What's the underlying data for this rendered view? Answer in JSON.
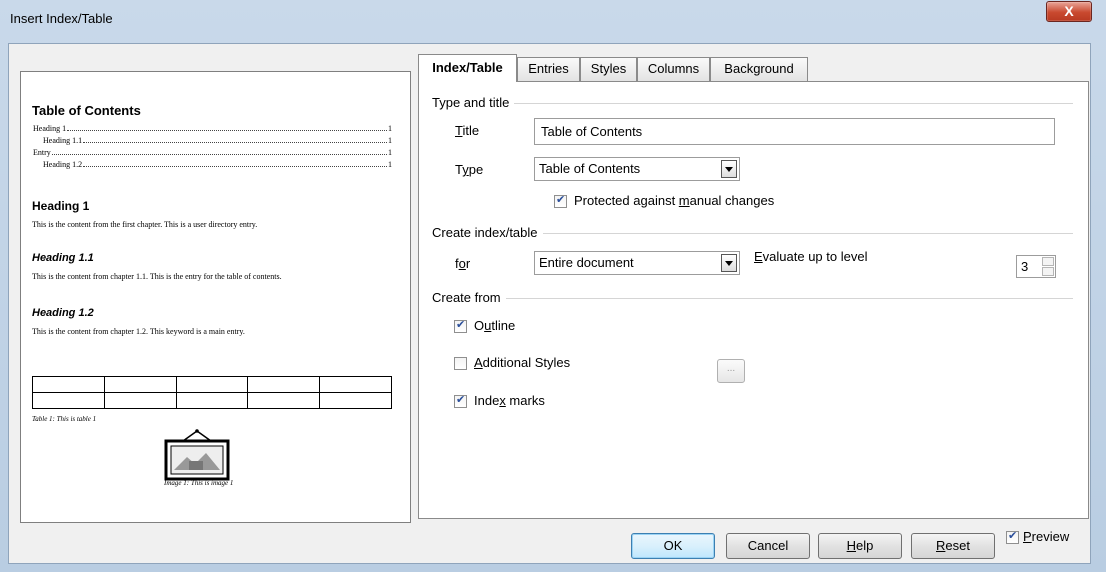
{
  "window": {
    "title": "Insert Index/Table",
    "close_glyph": "X"
  },
  "preview": {
    "toc_title": "Table of Contents",
    "toc_entries": [
      {
        "label": "Heading 1",
        "page": "1"
      },
      {
        "label": "Heading 1.1",
        "page": "1"
      },
      {
        "label": "Entry",
        "page": "1"
      },
      {
        "label": "Heading 1.2",
        "page": "1"
      }
    ],
    "heading1": "Heading 1",
    "text1": "This is the content from the first chapter. This is a user directory entry.",
    "heading11": "Heading 1.1",
    "text11": "This is the content from chapter 1.1. This is the entry for the table of contents.",
    "heading12": "Heading 1.2",
    "text12": "This is the content from chapter 1.2. This keyword is a main entry.",
    "table_caption": "Table 1: This is table 1",
    "image_caption": "Image 1: This is image 1"
  },
  "tabs": [
    {
      "label": "Index/Table",
      "active": true
    },
    {
      "label": "Entries",
      "active": false
    },
    {
      "label": "Styles",
      "active": false
    },
    {
      "label": "Columns",
      "active": false
    },
    {
      "label": "Background",
      "active": false
    }
  ],
  "type_title": {
    "group": "Type and title",
    "title_label_pre": "",
    "title_label_u": "T",
    "title_label_post": "itle",
    "title_value": "Table of Contents",
    "type_label_pre": "T",
    "type_label_u": "y",
    "type_label_post": "pe",
    "type_value": "Table of Contents",
    "protected_pre": "Protected against ",
    "protected_u": "m",
    "protected_post": "anual changes",
    "protected_checked": true
  },
  "create_index": {
    "group": "Create index/table",
    "for_pre": "f",
    "for_u": "o",
    "for_post": "r",
    "for_value": "Entire document",
    "evaluate_pre": "",
    "evaluate_u": "E",
    "evaluate_post": "valuate up to level",
    "level_value": "3"
  },
  "create_from": {
    "group": "Create from",
    "outline_pre": "O",
    "outline_u": "u",
    "outline_post": "tline",
    "outline_checked": true,
    "additional_pre": "",
    "additional_u": "A",
    "additional_post": "dditional Styles",
    "additional_checked": false,
    "styles_button": "...",
    "index_marks_pre": "Inde",
    "index_marks_u": "x",
    "index_marks_post": " marks",
    "index_marks_checked": true
  },
  "buttons": {
    "ok": "OK",
    "cancel": "Cancel",
    "help_pre": "",
    "help_u": "H",
    "help_post": "elp",
    "reset_pre": "",
    "reset_u": "R",
    "reset_post": "eset",
    "preview_pre": "",
    "preview_u": "P",
    "preview_post": "review",
    "preview_checked": true
  },
  "colors": {
    "accent": "#3c7fb1",
    "check": "#2a4e9a",
    "close": "#c9492f"
  }
}
